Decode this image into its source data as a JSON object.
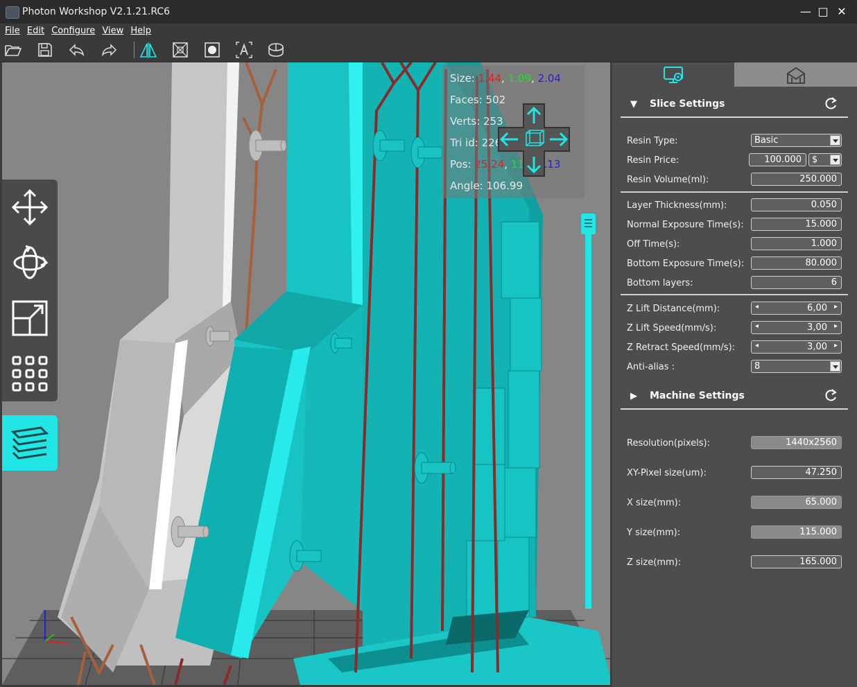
{
  "window": {
    "title": "Photon Workshop V2.1.21.RC6",
    "minimize": "—",
    "maximize": "□",
    "close": "✕"
  },
  "menu": [
    "File",
    "Edit",
    "Configure",
    "View",
    "Help"
  ],
  "toolbar": {
    "buttons": [
      "open-folder-icon",
      "save-icon",
      "undo-icon",
      "redo-icon",
      "mirror-icon",
      "hollow-icon",
      "punch-hole-icon",
      "text-icon",
      "volume-icon"
    ]
  },
  "info": {
    "size_label": "Size:",
    "size_x": "1.44",
    "size_sep1": ",",
    "size_y": "1.09",
    "size_sep2": ",",
    "size_z": "2.04",
    "faces": "Faces: 502",
    "verts": "Verts: 253",
    "tri_id": "Tri id: 226",
    "pos_label": "Pos:",
    "pos_x": "25.24",
    "pos_sep1": ",",
    "pos_y": "11",
    "pos_sep2": ",",
    "pos_z": "40.13",
    "angle": "Angle: 106.99"
  },
  "left_tools": [
    "move-icon",
    "rotate-icon",
    "scale-icon",
    "arrange-icon"
  ],
  "layer_tool": "layers-icon",
  "colors": {
    "accent": "#22e5e5",
    "model": "#14c0c0",
    "support": "#8a2a2a",
    "panel": "#4d4d4d"
  },
  "slice_settings": {
    "title": "Slice Settings",
    "resin_type_label": "Resin Type:",
    "resin_type": "Basic",
    "resin_price_label": "Resin Price:",
    "resin_price": "100.000",
    "currency": "$",
    "resin_volume_label": "Resin Volume(ml):",
    "resin_volume": "250.000",
    "layer_thickness_label": "Layer Thickness(mm):",
    "layer_thickness": "0.050",
    "normal_exposure_label": "Normal Exposure Time(s):",
    "normal_exposure": "15.000",
    "off_time_label": "Off Time(s):",
    "off_time": "1.000",
    "bottom_exposure_label": "Bottom Exposure Time(s):",
    "bottom_exposure": "80.000",
    "bottom_layers_label": "Bottom layers:",
    "bottom_layers": "6",
    "z_lift_distance_label": "Z Lift Distance(mm):",
    "z_lift_distance": "6,00",
    "z_lift_speed_label": "Z Lift Speed(mm/s):",
    "z_lift_speed": "3,00",
    "z_retract_speed_label": "Z Retract Speed(mm/s):",
    "z_retract_speed": "3,00",
    "anti_alias_label": "Anti-alias :",
    "anti_alias": "8"
  },
  "machine_settings": {
    "title": "Machine Settings",
    "resolution_label": "Resolution(pixels):",
    "resolution": "1440x2560",
    "xy_pixel_label": "XY-Pixel size(um):",
    "xy_pixel": "47.250",
    "x_size_label": "X size(mm):",
    "x_size": "65.000",
    "y_size_label": "Y size(mm):",
    "y_size": "115.000",
    "z_size_label": "Z size(mm):",
    "z_size": "165.000"
  }
}
